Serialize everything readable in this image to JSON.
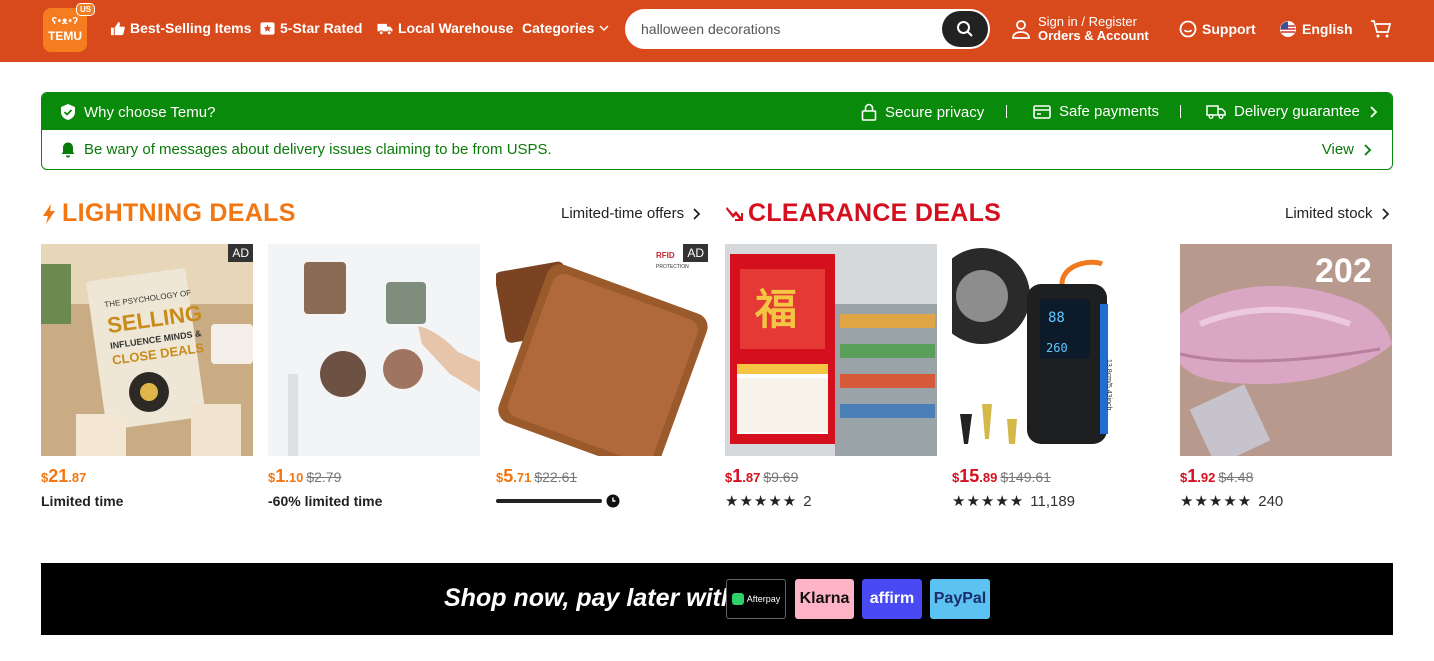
{
  "header": {
    "logo_top": "ʕ•ᴥ•ʔ",
    "logo_word": "TEMU",
    "region_badge": "US",
    "nav": [
      {
        "label": "Best-Selling Items",
        "icon": "thumbs-up-icon"
      },
      {
        "label": "5-Star Rated",
        "icon": "star-badge-icon"
      },
      {
        "label": "Local Warehouse",
        "icon": "truck-icon"
      },
      {
        "label": "Categories",
        "icon": "chevron-down-icon"
      }
    ],
    "search_value": "halloween decorations",
    "account_line1": "Sign in / Register",
    "account_line2": "Orders & Account",
    "support": "Support",
    "language": "English"
  },
  "trust": {
    "why": "Why choose Temu?",
    "features": [
      "Secure privacy",
      "Safe payments",
      "Delivery guarantee"
    ],
    "notice": "Be wary of messages about delivery issues claiming to be from USPS.",
    "view": "View"
  },
  "lightning": {
    "title": "LIGHTNING DEALS",
    "link": "Limited-time offers",
    "items": [
      {
        "name": "The Psychology of Selling book",
        "currency": "$",
        "whole": "21",
        "cents": ".87",
        "old": "",
        "sub": "Limited time",
        "ad": "AD"
      },
      {
        "name": "Custom photo fridge magnets",
        "currency": "$",
        "whole": "1",
        "cents": ".10",
        "old": "$2.79",
        "sub": "-60% limited time",
        "ad": ""
      },
      {
        "name": "Brown leather RFID wallet",
        "currency": "$",
        "whole": "5",
        "cents": ".71",
        "old": "$22.61",
        "sub": "",
        "ad": "AD",
        "progress": 0.9
      }
    ]
  },
  "clearance": {
    "title": "CLEARANCE DEALS",
    "link": "Limited stock",
    "items": [
      {
        "name": "Chinese new year wall calendar",
        "currency": "$",
        "whole": "1",
        "cents": ".87",
        "old": "$9.69",
        "stars": "★★★★★",
        "count": "2"
      },
      {
        "name": "Portable tire inflator",
        "currency": "$",
        "whole": "15",
        "cents": ".89",
        "old": "$149.61",
        "stars": "★★★★★",
        "count": "11,189"
      },
      {
        "name": "Pink lip gloss",
        "currency": "$",
        "whole": "1",
        "cents": ".92",
        "old": "$4.48",
        "stars": "★★★★★",
        "count": "240"
      }
    ]
  },
  "bnpl": {
    "text": "Shop now, pay later with",
    "providers": [
      "Afterpay",
      "Klarna",
      "affirm",
      "PayPal"
    ]
  },
  "colors": {
    "header": "#d84a1b",
    "green": "#0a8a0a",
    "lightning": "#f27712",
    "clearance": "#d4101e"
  }
}
